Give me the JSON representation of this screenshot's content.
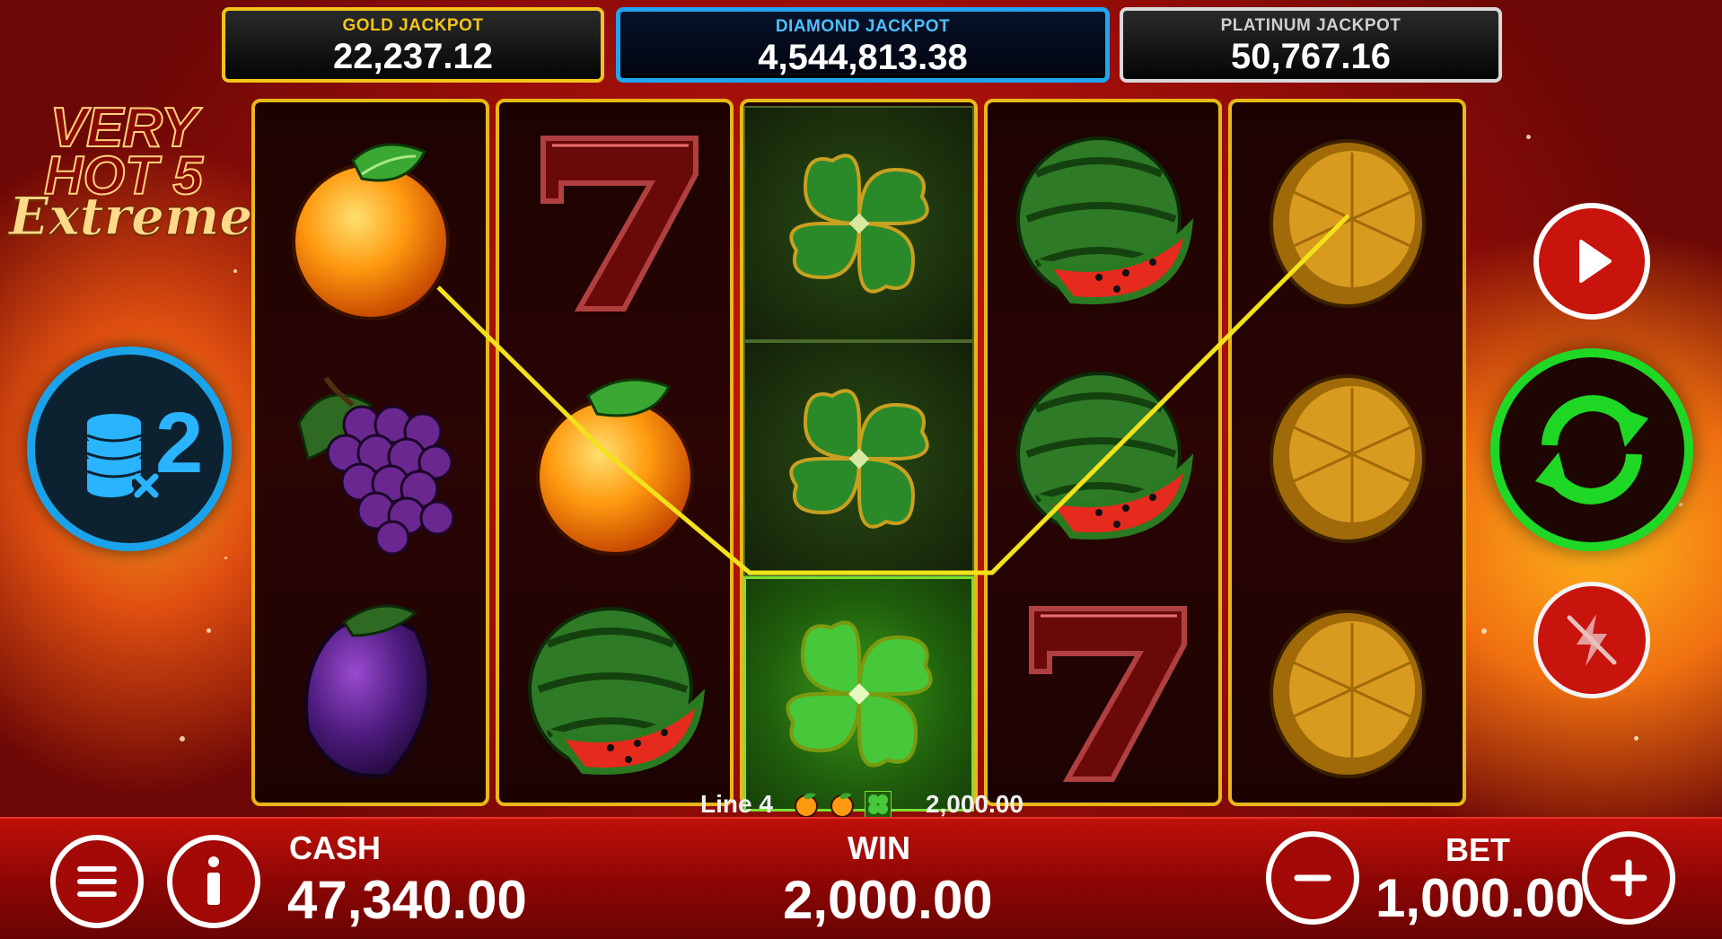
{
  "jackpots": {
    "gold": {
      "label": "GOLD JACKPOT",
      "value": "22,237.12"
    },
    "diamond": {
      "label": "DIAMOND JACKPOT",
      "value": "4,544,813.38"
    },
    "platinum": {
      "label": "PLATINUM JACKPOT",
      "value": "50,767.16"
    }
  },
  "logo": {
    "line1": "VERY",
    "line2": "HOT 5",
    "line3": "Extreme"
  },
  "multiplier": {
    "text": "2",
    "icon": "coin-stack-icon"
  },
  "reels": [
    [
      "orange",
      "grapes",
      "plum"
    ],
    [
      "seven",
      "orange",
      "watermelon"
    ],
    [
      "clover",
      "clover",
      "clover"
    ],
    [
      "watermelon",
      "watermelon",
      "seven"
    ],
    [
      "lemon",
      "lemon",
      "lemon"
    ]
  ],
  "win_line": {
    "label": "Line 4",
    "symbols": [
      "orange",
      "orange",
      "clover"
    ],
    "amount": "2,000.00",
    "color": "#f2e21a"
  },
  "controls": {
    "menu_icon": "menu-icon",
    "info_icon": "info-icon",
    "autoplay_icon": "play-icon",
    "spin_icon": "spin-arrows-icon",
    "turbo_icon": "turbo-off-icon",
    "minus_icon": "minus-icon",
    "plus_icon": "plus-icon"
  },
  "status": {
    "cash_label": "CASH",
    "cash_value": "47,340.00",
    "win_label": "WIN",
    "win_value": "2,000.00",
    "bet_label": "BET",
    "bet_value": "1,000.00"
  },
  "colors": {
    "gold": "#f3c41a",
    "diamond": "#1ea6ee",
    "spin": "#1ed825"
  }
}
